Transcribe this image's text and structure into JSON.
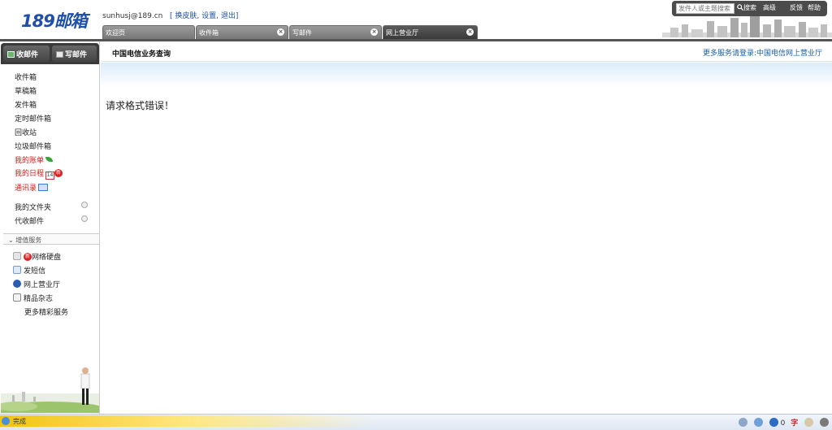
{
  "brand": {
    "logo": "189邮箱"
  },
  "user": {
    "email": "sunhusj@189.cn",
    "skin_link": "换皮肤",
    "settings_link": "设置",
    "logout_link": "退出",
    "open_bracket": "[",
    "close_bracket": "]",
    "comma": ","
  },
  "search": {
    "placeholder": "发件人或主题搜索",
    "button": "搜索",
    "advanced": "高级",
    "feedback": "反馈",
    "help": "帮助"
  },
  "tabs": [
    {
      "label": "欢迎页",
      "closable": false
    },
    {
      "label": "收件箱",
      "closable": true
    },
    {
      "label": "写邮件",
      "closable": true
    },
    {
      "label": "网上营业厅",
      "closable": true,
      "active": true
    }
  ],
  "sidebar": {
    "inbox_button": "收邮件",
    "compose_button": "写邮件",
    "folders": [
      "收件箱",
      "草稿箱",
      "发件箱",
      "定时邮件箱",
      "回收站",
      "垃圾邮件箱"
    ],
    "bill": "我的账单",
    "schedule": "我的日程",
    "calendar_day": "14",
    "new_badge": "新",
    "contacts": "通讯录",
    "my_folders": "我的文件夹",
    "agent_mail": "代收邮件",
    "vas_header": "增值服务",
    "vas_items": [
      "网络硬盘",
      "发短信",
      "网上营业厅",
      "精品杂志",
      "更多精彩服务"
    ]
  },
  "main": {
    "title": "中国电信业务查询",
    "more_link": "更多服务请登录:中国电信网上营业厅",
    "error_text": "请求格式错误！"
  },
  "status": {
    "text": "完成",
    "zoom_value": "0",
    "char_icon": "字"
  },
  "colors": {
    "brand_blue": "#1f4fa8",
    "link_blue": "#1a5fa8",
    "red": "#d21c1c",
    "dark_bar": "#3a3a3a"
  }
}
